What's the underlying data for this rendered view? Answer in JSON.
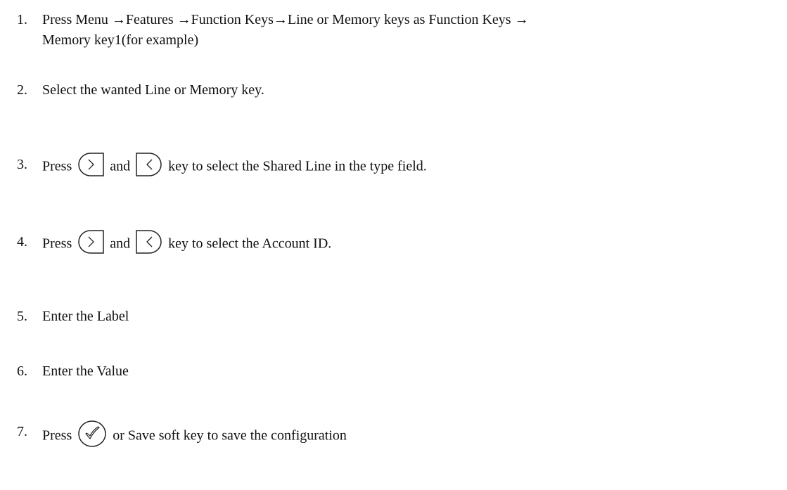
{
  "steps": [
    {
      "number": "1.",
      "line1": "Press Menu →Features →Function Keys→Line or Memory keys as Function Keys →",
      "line2": "Memory key1(for example)"
    },
    {
      "number": "2.",
      "text": "Select the wanted Line or Memory key."
    },
    {
      "number": "3.",
      "before": "Press",
      "middle": "and",
      "after": "key to select the Shared Line in the type field.",
      "icons": [
        "right-arrow-key-icon",
        "left-arrow-key-icon"
      ]
    },
    {
      "number": "4.",
      "before": "Press",
      "middle": "and",
      "after": "key to select the Account ID.",
      "icons": [
        "right-arrow-key-icon",
        "left-arrow-key-icon"
      ]
    },
    {
      "number": "5.",
      "text": "Enter the Label"
    },
    {
      "number": "6.",
      "text": "Enter the Value"
    },
    {
      "number": "7.",
      "before": "Press",
      "after": "or Save soft key to save the configuration",
      "icons": [
        "ok-check-key-icon"
      ]
    }
  ],
  "colors": {
    "text": "#111111",
    "icon_stroke": "#222222",
    "background": "#ffffff"
  }
}
